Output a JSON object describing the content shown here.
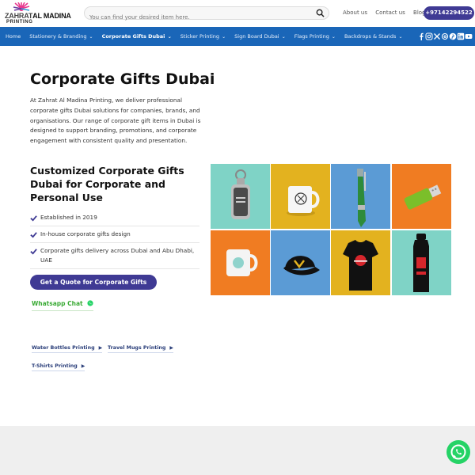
{
  "brand": {
    "name_part1": "ZAHRAT",
    "name_part2": "AL MADINA",
    "name_line2": "PRINTING"
  },
  "search": {
    "placeholder": "You can find your desired item here."
  },
  "top_links": [
    "About us",
    "Contact us",
    "Blog"
  ],
  "phone": "+97142294522",
  "nav": {
    "items": [
      {
        "label": "Home",
        "has_dropdown": false,
        "active": false
      },
      {
        "label": "Stationery & Branding",
        "has_dropdown": true,
        "active": false
      },
      {
        "label": "Corporate Gifts Dubai",
        "has_dropdown": true,
        "active": true
      },
      {
        "label": "Sticker Printing",
        "has_dropdown": true,
        "active": false
      },
      {
        "label": "Sign Board Dubai",
        "has_dropdown": true,
        "active": false
      },
      {
        "label": "Flags Printing",
        "has_dropdown": true,
        "active": false
      },
      {
        "label": "Backdrops & Stands",
        "has_dropdown": true,
        "active": false
      }
    ],
    "chevron": "⌄",
    "social_icons": [
      "facebook-icon",
      "instagram-icon",
      "x-icon",
      "threads-icon",
      "pinterest-icon",
      "linkedin-icon",
      "youtube-icon"
    ]
  },
  "main": {
    "title": "Corporate Gifts Dubai",
    "intro": "At Zahrat Al Madina Printing, we deliver professional corporate gifts Dubai solutions for companies, brands, and organisations. Our range of corporate gift items in Dubai is designed to support branding, promotions, and corporate engagement with consistent quality and presentation.",
    "subtitle": "Customized Corporate Gifts Dubai for Corporate and Personal Use",
    "features": [
      "Established in 2019",
      "In-house corporate gifts design",
      "Corporate gifts delivery across Dubai and Abu Dhabi, UAE"
    ],
    "quote_button": "Get a Quote for Corporate Gifts",
    "whatsapp_link": "Whatsapp Chat"
  },
  "products": [
    {
      "icon": "keychain-icon",
      "bg": "#7fd3c6"
    },
    {
      "icon": "mug-icon",
      "bg": "#e3b21f"
    },
    {
      "icon": "pen-icon",
      "bg": "#5b9bd5"
    },
    {
      "icon": "usb-drive-icon",
      "bg": "#f07c22"
    },
    {
      "icon": "white-mug-icon",
      "bg": "#f07c22"
    },
    {
      "icon": "cap-icon",
      "bg": "#5b9bd5"
    },
    {
      "icon": "tshirt-icon",
      "bg": "#e3b21f"
    },
    {
      "icon": "water-bottle-icon",
      "bg": "#7fd3c6"
    }
  ],
  "related_links": [
    {
      "label": "Water Bottles Printing"
    },
    {
      "label": "Travel Mugs Printing"
    },
    {
      "label": "T-Shirts Printing"
    }
  ],
  "arrow": "▶",
  "colors": {
    "brand_purple": "#3f3a94",
    "nav_blue": "#1a66b8",
    "whatsapp_green": "#25d366"
  }
}
